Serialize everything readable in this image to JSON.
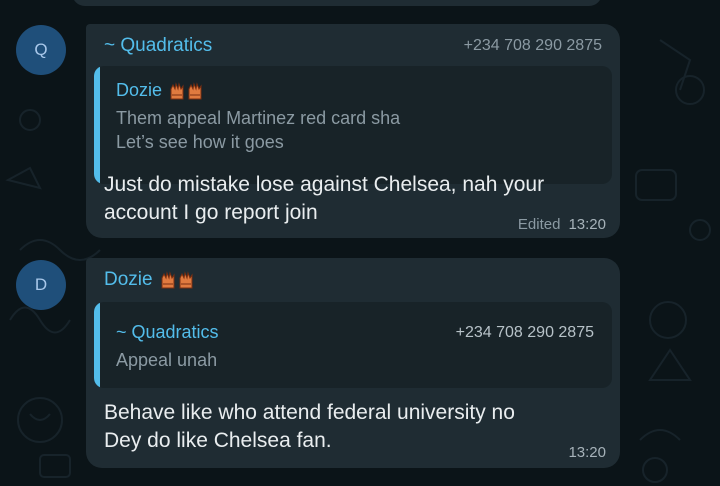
{
  "messages": [
    {
      "avatar_letter": "Q",
      "sender": "~ Quadratics",
      "phone": "+234 708 290 2875",
      "quoted": {
        "name": "Dozie",
        "lines": [
          "Them appeal Martinez red card sha",
          "Let’s see how it goes"
        ]
      },
      "text_lines": [
        "Just do mistake lose against Chelsea, nah your",
        "account I go report join"
      ],
      "edited_label": "Edited",
      "time": "13:20"
    },
    {
      "avatar_letter": "D",
      "sender": "Dozie",
      "quoted": {
        "name": "~ Quadratics",
        "phone": "+234 708 290 2875",
        "lines": [
          "Appeal unah"
        ]
      },
      "text_lines": [
        "Behave like who attend federal university no",
        "Dey do like Chelsea fan."
      ],
      "time": "13:20"
    }
  ],
  "icons": {
    "sender_badge": "goalkeeper-gloves-icon"
  },
  "colors": {
    "background": "#0b1418",
    "bubble": "#1f2c33",
    "quote_bg": "#182328",
    "accent": "#53bdeb",
    "avatar": "#1f4f7a",
    "glove": "#e07a3f"
  }
}
